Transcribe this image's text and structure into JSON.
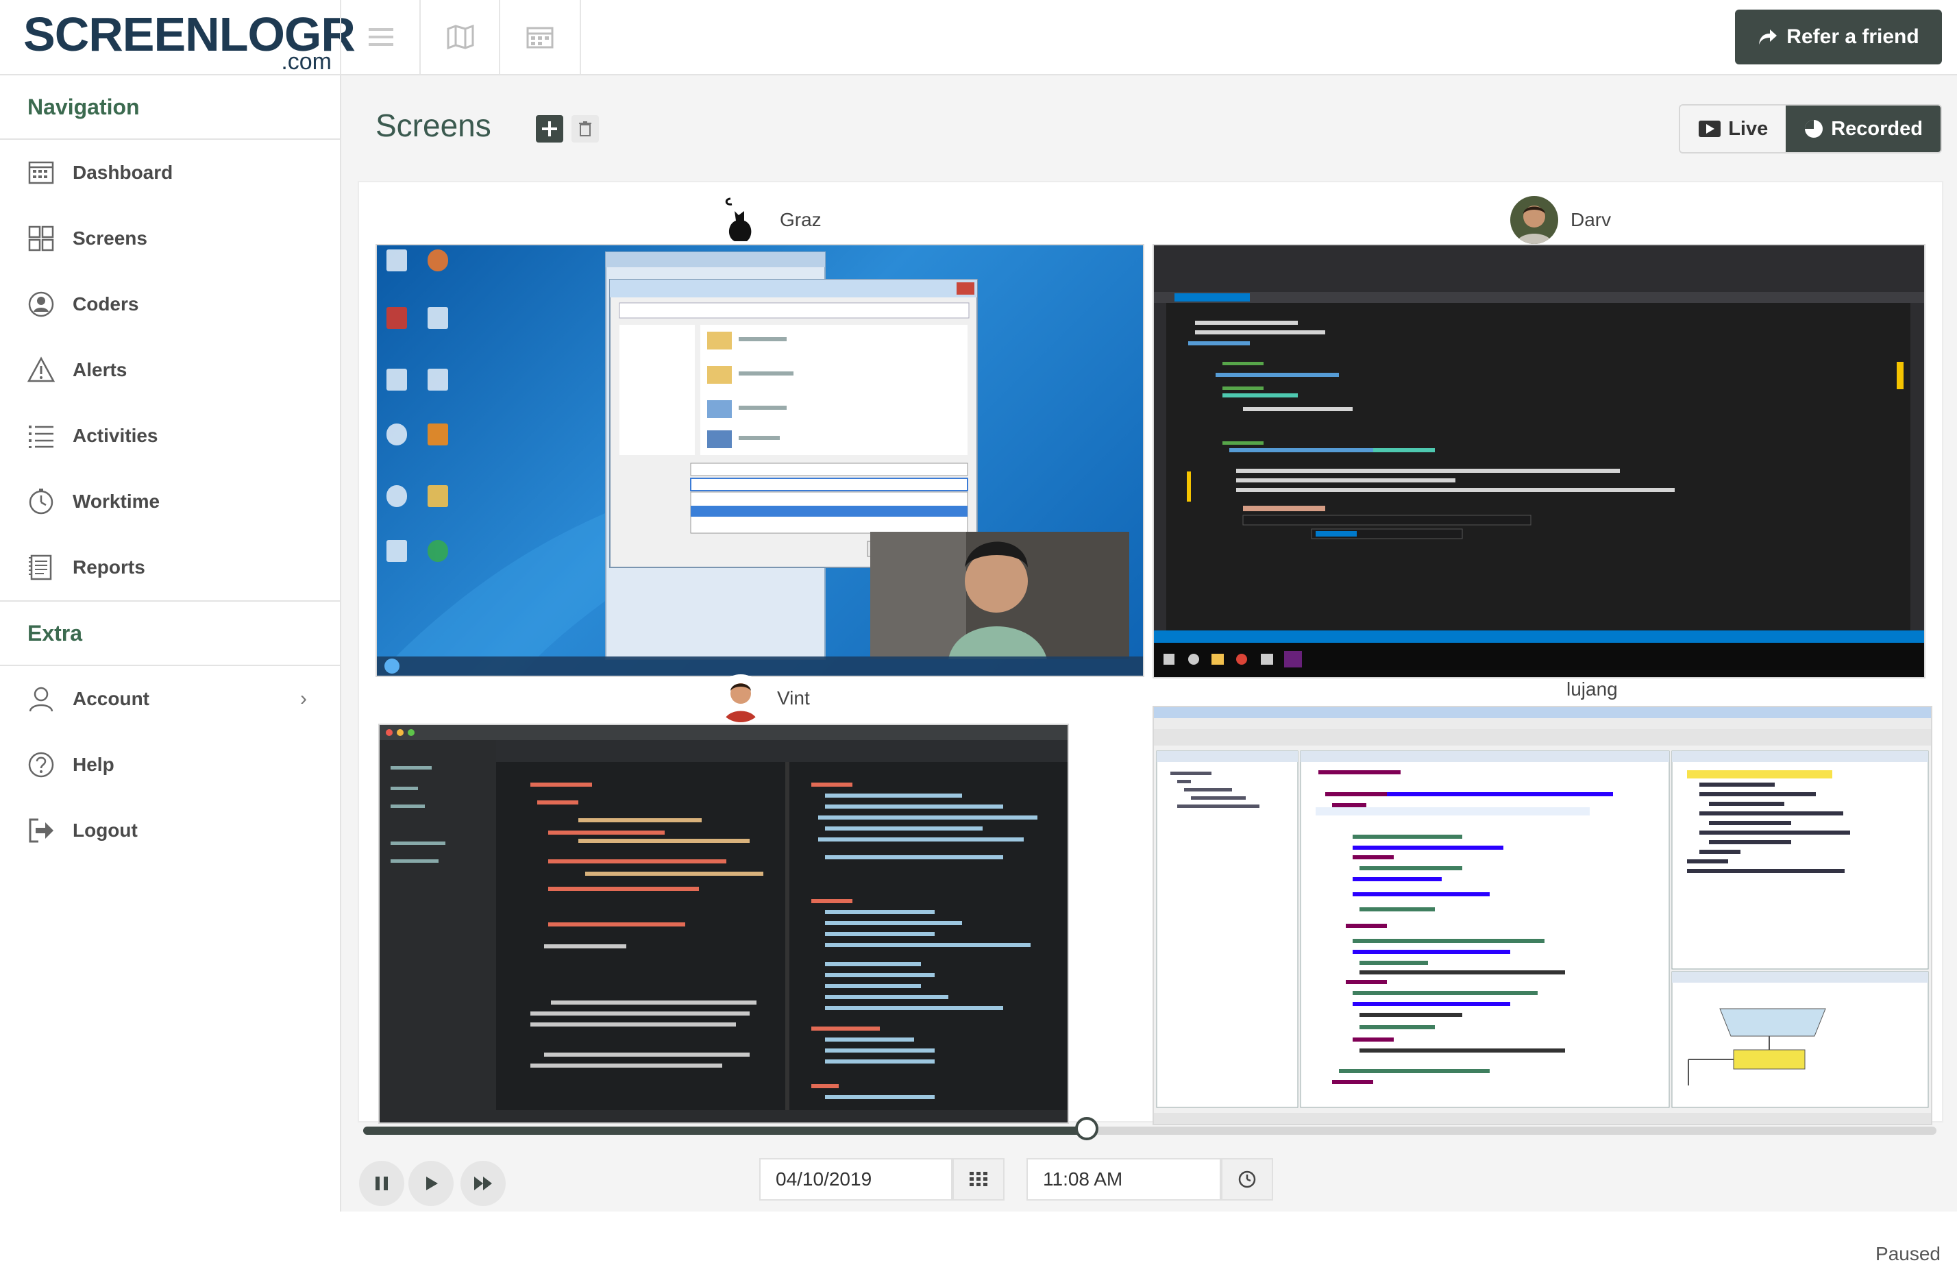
{
  "app": {
    "logo_main": "SCREENLOGR",
    "logo_suffix": ".com",
    "refer_label": "Refer a friend"
  },
  "sidebar": {
    "sections": [
      {
        "title": "Navigation",
        "items": [
          {
            "label": "Dashboard",
            "icon": "dashboard-icon"
          },
          {
            "label": "Screens",
            "icon": "screens-icon"
          },
          {
            "label": "Coders",
            "icon": "coders-icon"
          },
          {
            "label": "Alerts",
            "icon": "alert-icon"
          },
          {
            "label": "Activities",
            "icon": "activities-icon"
          },
          {
            "label": "Worktime",
            "icon": "clock-icon"
          },
          {
            "label": "Reports",
            "icon": "reports-icon"
          }
        ]
      },
      {
        "title": "Extra",
        "items": [
          {
            "label": "Account",
            "icon": "account-icon",
            "chevron": "›"
          },
          {
            "label": "Help",
            "icon": "help-icon"
          },
          {
            "label": "Logout",
            "icon": "logout-icon"
          }
        ]
      }
    ]
  },
  "page": {
    "title": "Screens",
    "mode_live": "Live",
    "mode_recorded": "Recorded",
    "active_mode": "Recorded"
  },
  "screens": [
    {
      "user": "Graz",
      "content": "Windows desktop with Save As dialog and webcam overlay"
    },
    {
      "user": "Darv",
      "content": "Microsoft Visual Studio C# code editor"
    },
    {
      "user": "Vint",
      "content": "Brackets code editor with HTML/CSS"
    },
    {
      "user": "lujang",
      "content": "Eclipse SDK Java editor with pseudocode and flowchart"
    }
  ],
  "player": {
    "date": "04/10/2019",
    "time": "11:08 AM",
    "status": "Paused",
    "progress": 0.46
  },
  "colors": {
    "accent": "#3f4a46",
    "nav_heading": "#3b6a4f",
    "logo": "#1e3a52"
  }
}
